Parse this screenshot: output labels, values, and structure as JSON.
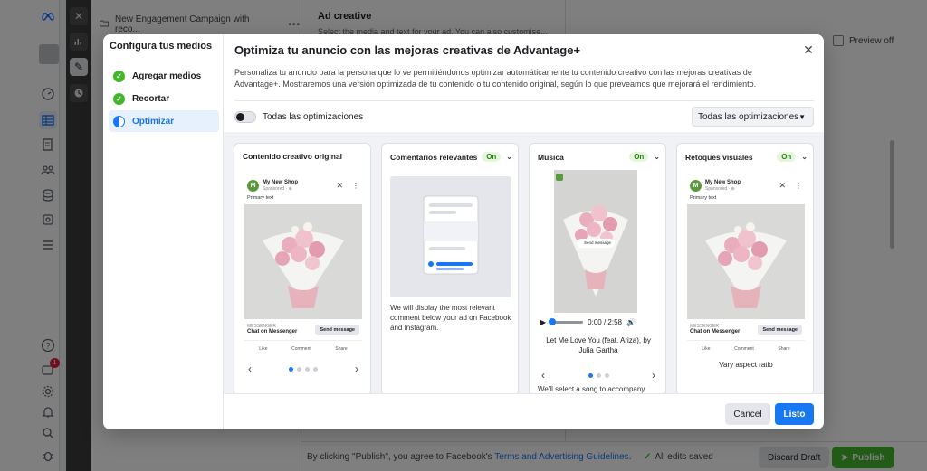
{
  "background": {
    "campaign_name": "New Engagement Campaign with reco...",
    "ad_creative_title": "Ad creative",
    "ad_creative_subtitle": "Select the media and text for your ad. You can also customise...",
    "preview_off_label": "Preview off",
    "publish_notice_prefix": "By clicking \"Publish\", you agree to Facebook's ",
    "publish_notice_link": "Terms and Advertising Guidelines",
    "publish_notice_suffix": ".",
    "edits_saved": "All edits saved",
    "discard_draft": "Discard Draft",
    "publish": "Publish",
    "notification_count": "1"
  },
  "modal": {
    "sidebar": {
      "title": "Configura tus medios",
      "steps": [
        {
          "label": "Agregar medios",
          "state": "done"
        },
        {
          "label": "Recortar",
          "state": "done"
        },
        {
          "label": "Optimizar",
          "state": "active"
        }
      ]
    },
    "title": "Optimiza tu anuncio con las mejoras creativas de Advantage+",
    "description": "Personaliza tu anuncio para la persona que lo ve permitiéndonos optimizar automáticamente tu contenido creativo con las mejoras creativas de Advantage+. Mostraremos una versión optimizada de tu contenido o tu contenido original, según lo que preveamos que mejorará el rendimiento.",
    "toggle_label": "Todas las optimizaciones",
    "select_value": "Todas las optimizaciones",
    "cards": {
      "original": {
        "title": "Contenido creativo original",
        "shop": "My New Shop",
        "sponsored": "Sponsored · ⊕",
        "primary_text": "Primary text",
        "messenger": "MESSENGER",
        "chat": "Chat on Messenger",
        "send": "Send message",
        "like": "Like",
        "comment": "Comment",
        "share": "Share"
      },
      "comments": {
        "title": "Comentarios relevantes",
        "badge": "On",
        "text": "We will display the most relevant comment below your ad on Facebook and Instagram."
      },
      "music": {
        "title": "Música",
        "badge": "On",
        "story_cta": "Send message",
        "time": "0:00 / 2:58",
        "song": "Let Me Love You (feat. Ariza), by Julia Gartha",
        "text": "We'll select a song to accompany your"
      },
      "visual": {
        "title": "Retoques visuales",
        "badge": "On",
        "shop": "My New Shop",
        "sponsored": "Sponsored · ⊕",
        "primary_text": "Primary text",
        "messenger": "MESSENGER",
        "chat": "Chat on Messenger",
        "send": "Send message",
        "like": "Like",
        "comment": "Comment",
        "share": "Share",
        "caption": "Vary aspect ratio"
      }
    },
    "cancel": "Cancel",
    "done": "Listo"
  },
  "colors": {
    "accent": "#1877f2",
    "success": "#42b72a",
    "on_badge_bg": "#e4f6dc"
  }
}
